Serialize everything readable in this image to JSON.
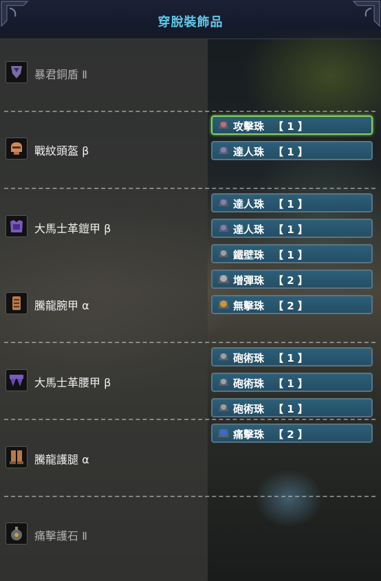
{
  "title": "穿脫裝飾品",
  "equipment": [
    {
      "name": "暴君銅盾 Ⅱ",
      "icon": "shield-icon",
      "dim": true
    },
    {
      "name": "戰紋頭盔 β",
      "icon": "helm-icon"
    },
    {
      "name": "大馬士革鎧甲 β",
      "icon": "chest-armor-icon"
    },
    {
      "name": "騰龍腕甲 α",
      "icon": "arm-armor-icon"
    },
    {
      "name": "大馬士革腰甲 β",
      "icon": "waist-armor-icon"
    },
    {
      "name": "騰龍護腿 α",
      "icon": "leg-armor-icon"
    },
    {
      "name": "痛擊護石 Ⅱ",
      "icon": "charm-icon",
      "dim": true
    }
  ],
  "decorations": [
    {
      "name": "攻擊珠",
      "level": "【 1 】",
      "gem_color": "#c46a7a",
      "selected": true
    },
    {
      "name": "達人珠",
      "level": "【 1 】",
      "gem_color": "#8a7ab8"
    },
    {
      "name": "達人珠",
      "level": "【 1 】",
      "gem_color": "#8a7ab8"
    },
    {
      "name": "達人珠",
      "level": "【 1 】",
      "gem_color": "#8a7ab8"
    },
    {
      "name": "鐵壁珠",
      "level": "【 1 】",
      "gem_color": "#9aa0a6"
    },
    {
      "name": "增彈珠",
      "level": "【 2 】",
      "gem_color": "#a8aeb4"
    },
    {
      "name": "無擊珠",
      "level": "【 2 】",
      "gem_color": "#c8953a"
    },
    {
      "name": "砲術珠",
      "level": "【 1 】",
      "gem_color": "#9aa0a6"
    },
    {
      "name": "砲術珠",
      "level": "【 1 】",
      "gem_color": "#9aa0a6"
    },
    {
      "name": "砲術珠",
      "level": "【 1 】",
      "gem_color": "#9aa0a6"
    },
    {
      "name": "痛擊珠",
      "level": "【 2 】",
      "gem_color": "#3a6ad0"
    }
  ]
}
